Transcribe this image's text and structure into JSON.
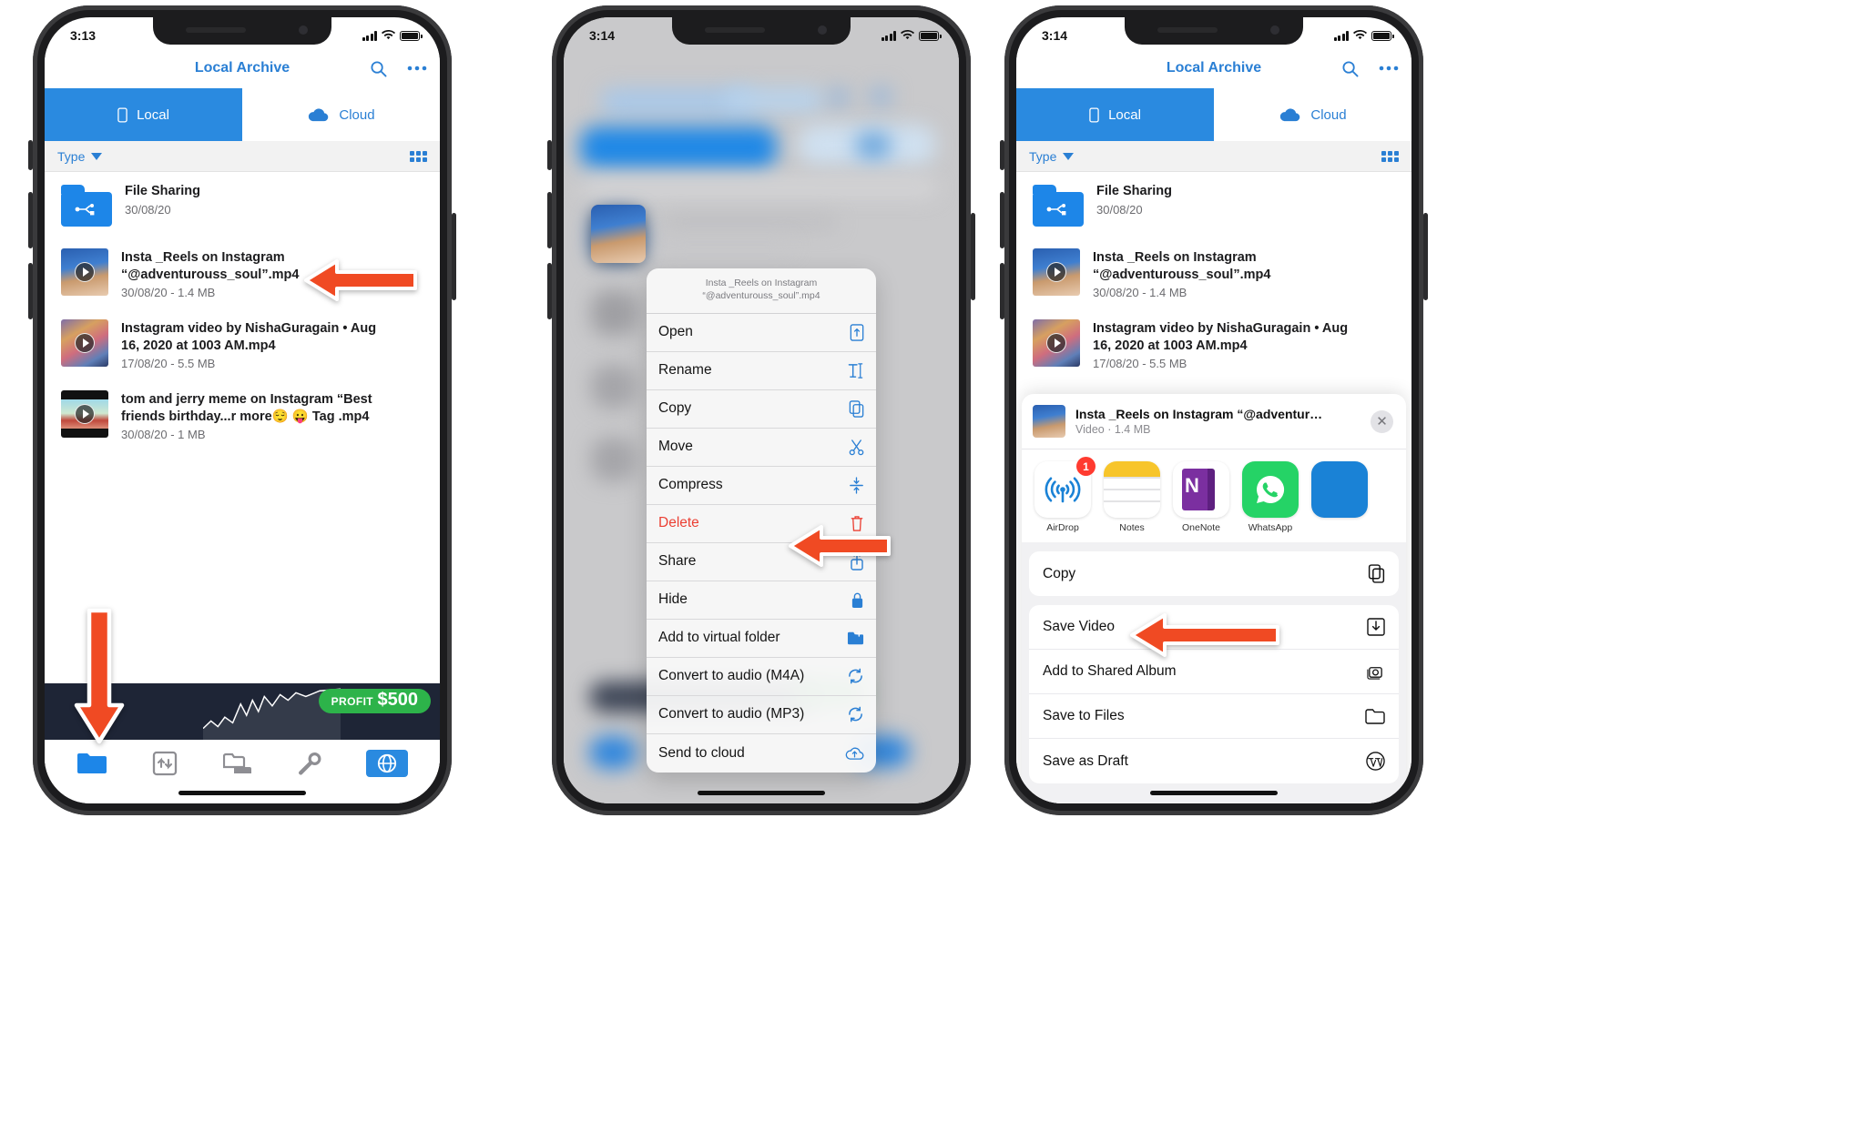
{
  "colors": {
    "accent_blue": "#2a8ae0",
    "link_blue": "#2a7fd4",
    "danger_red": "#eb4034",
    "arrow_orange": "#f04a23",
    "ad_green": "#2db34a"
  },
  "phones": [
    {
      "status": {
        "time": "3:13",
        "battery": "100"
      },
      "nav": {
        "title": "Local Archive",
        "search_icon": "search-icon",
        "more_icon": "more-icon"
      },
      "tabs": [
        {
          "label": "Local",
          "icon": "phone-icon",
          "active": true
        },
        {
          "label": "Cloud",
          "icon": "cloud-icon",
          "active": false
        }
      ],
      "sortbar": {
        "label": "Type",
        "caret": "chevron-down-icon",
        "grid_icon": "grid-view-icon"
      },
      "files": [
        {
          "name": "File Sharing",
          "sub": "30/08/20",
          "kind": "folder"
        },
        {
          "name": "Insta _Reels on Instagram “@adventurouss_soul”.mp4",
          "sub": "30/08/20 - 1.4 MB",
          "kind": "video"
        },
        {
          "name": "Instagram video by NishaGuragain • Aug 16, 2020 at 1003 AM.mp4",
          "sub": "17/08/20 - 5.5 MB",
          "kind": "video"
        },
        {
          "name": "tom and jerry meme on Instagram “Best friends birthday...r more😌 😛  Tag .mp4",
          "sub": "30/08/20 - 1 MB",
          "kind": "video"
        }
      ],
      "ad": {
        "title": "PROFIT",
        "amount": "$500"
      },
      "tabbar": [
        {
          "icon": "folder-icon",
          "name": "files-tab",
          "active": true
        },
        {
          "icon": "transfer-icon",
          "name": "transfer-tab",
          "active": false
        },
        {
          "icon": "folders-icon",
          "name": "folders-tab",
          "active": false
        },
        {
          "icon": "wrench-icon",
          "name": "tools-tab",
          "active": false
        },
        {
          "icon": "globe-icon",
          "name": "browser-tab",
          "active": false
        }
      ]
    },
    {
      "status": {
        "time": "3:14",
        "battery": "100"
      },
      "menu": {
        "header": "Insta _Reels on Instagram “@adventurouss_soul”.mp4",
        "items": [
          {
            "label": "Open",
            "icon": "open-document-icon",
            "danger": false
          },
          {
            "label": "Rename",
            "icon": "text-cursor-icon",
            "danger": false
          },
          {
            "label": "Copy",
            "icon": "copy-icon",
            "danger": false
          },
          {
            "label": "Move",
            "icon": "scissors-icon",
            "danger": false
          },
          {
            "label": "Compress",
            "icon": "compress-icon",
            "danger": false
          },
          {
            "label": "Delete",
            "icon": "trash-icon",
            "danger": true
          },
          {
            "label": "Share",
            "icon": "share-icon",
            "danger": false
          },
          {
            "label": "Hide",
            "icon": "lock-icon",
            "danger": false
          },
          {
            "label": "Add to virtual folder",
            "icon": "add-folder-icon",
            "danger": false
          },
          {
            "label": "Convert to audio (M4A)",
            "icon": "convert-icon",
            "danger": false
          },
          {
            "label": "Convert to audio (MP3)",
            "icon": "convert-icon",
            "danger": false
          },
          {
            "label": "Send to cloud",
            "icon": "cloud-upload-icon",
            "danger": false
          }
        ]
      }
    },
    {
      "status": {
        "time": "3:14",
        "battery": "100"
      },
      "nav": {
        "title": "Local Archive",
        "search_icon": "search-icon",
        "more_icon": "more-icon"
      },
      "tabs": [
        {
          "label": "Local",
          "icon": "phone-icon",
          "active": true
        },
        {
          "label": "Cloud",
          "icon": "cloud-icon",
          "active": false
        }
      ],
      "sortbar": {
        "label": "Type",
        "caret": "chevron-down-icon",
        "grid_icon": "grid-view-icon"
      },
      "files": [
        {
          "name": "File Sharing",
          "sub": "30/08/20",
          "kind": "folder"
        },
        {
          "name": "Insta _Reels on Instagram “@adventurouss_soul”.mp4",
          "sub": "30/08/20 - 1.4 MB",
          "kind": "video"
        },
        {
          "name": "Instagram video by NishaGuragain • Aug 16, 2020 at 1003 AM.mp4",
          "sub": "17/08/20 - 5.5 MB",
          "kind": "video"
        }
      ],
      "share_sheet": {
        "file_title": "Insta _Reels on Instagram “@adventur…",
        "file_sub": "Video · 1.4 MB",
        "close_label": "✕",
        "apps": [
          {
            "label": "AirDrop",
            "icon": "airdrop-icon",
            "badge": "1"
          },
          {
            "label": "Notes",
            "icon": "notes-icon",
            "badge": ""
          },
          {
            "label": "OneNote",
            "icon": "onenote-icon",
            "badge": ""
          },
          {
            "label": "WhatsApp",
            "icon": "whatsapp-icon",
            "badge": ""
          },
          {
            "label": "",
            "icon": "more-app-icon",
            "badge": ""
          }
        ],
        "actions": [
          {
            "label": "Copy",
            "icon": "copy-icon"
          },
          {
            "label": "Save Video",
            "icon": "save-download-icon"
          },
          {
            "label": "Add to Shared Album",
            "icon": "shared-album-icon"
          },
          {
            "label": "Save to Files",
            "icon": "folder-icon"
          },
          {
            "label": "Save as Draft",
            "icon": "wordpress-icon"
          }
        ]
      }
    }
  ],
  "annotations": [
    {
      "name": "arrow-pointing-to-file",
      "target": "Insta _Reels on Instagram “@adventurouss_soul”.mp4"
    },
    {
      "name": "arrow-pointing-to-files-tab",
      "target": "files-tab"
    },
    {
      "name": "arrow-pointing-to-share",
      "target": "Share"
    },
    {
      "name": "arrow-pointing-to-save-video",
      "target": "Save Video"
    }
  ]
}
